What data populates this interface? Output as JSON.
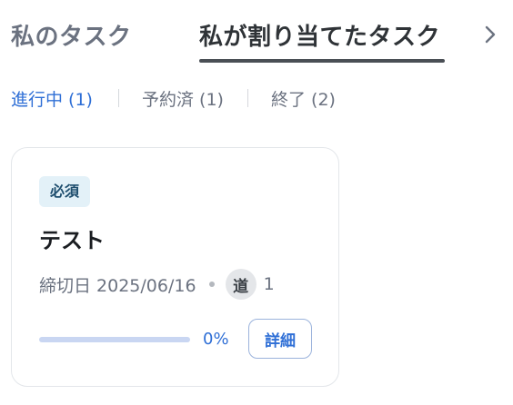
{
  "tabs": {
    "mine_label": "私のタスク",
    "assigned_label": "私が割り当てたタスク",
    "next_icon": "chevron-right-icon"
  },
  "filters": {
    "in_progress": "進行中 (1)",
    "reserved": "予約済 (1)",
    "completed": "終了 (2)"
  },
  "card": {
    "badge": "必須",
    "title": "テスト",
    "due_label": "締切日 2025/06/16",
    "avatar_text": "道",
    "assignee_count": "1",
    "progress_value": 0,
    "progress_text": "0%",
    "detail_button": "詳細"
  },
  "colors": {
    "accent": "#2f6fd6",
    "badge_bg": "#e3f1f8",
    "progress_track": "#c9d6f2"
  }
}
